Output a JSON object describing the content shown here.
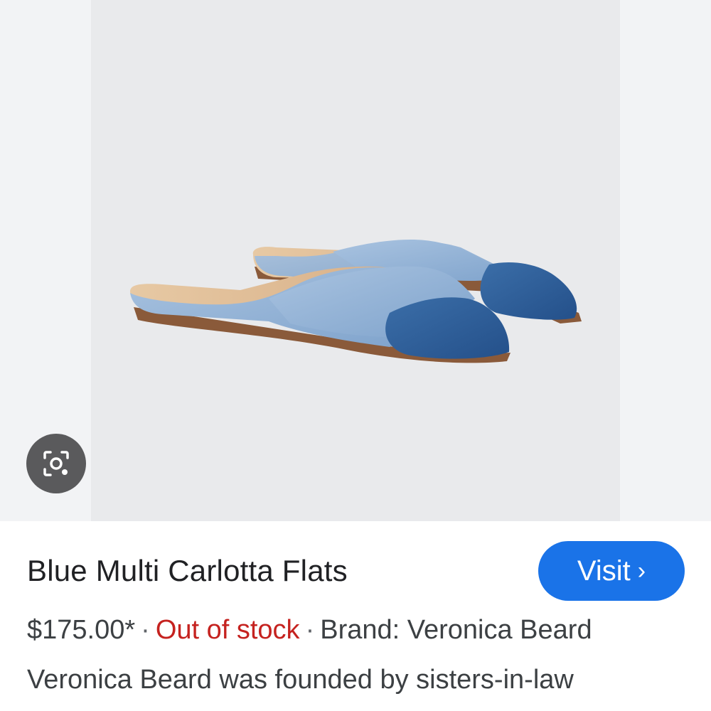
{
  "product": {
    "title": "Blue Multi Carlotta Flats",
    "price": "$175.00*",
    "separator": "·",
    "stock_status": "Out of stock",
    "brand": "Brand: Veronica Beard",
    "description": "Veronica Beard was founded by sisters-in-law",
    "image_alt": "Blue Multi Carlotta Flats denim mules"
  },
  "actions": {
    "visit_label": "Visit",
    "visit_chevron": "›",
    "lens_icon": "camera-lens-icon"
  },
  "colors": {
    "accent": "#1a73e8",
    "out_of_stock": "#c5221f",
    "denim_light": "#8eb0d4",
    "denim_dark": "#2e5e97"
  }
}
